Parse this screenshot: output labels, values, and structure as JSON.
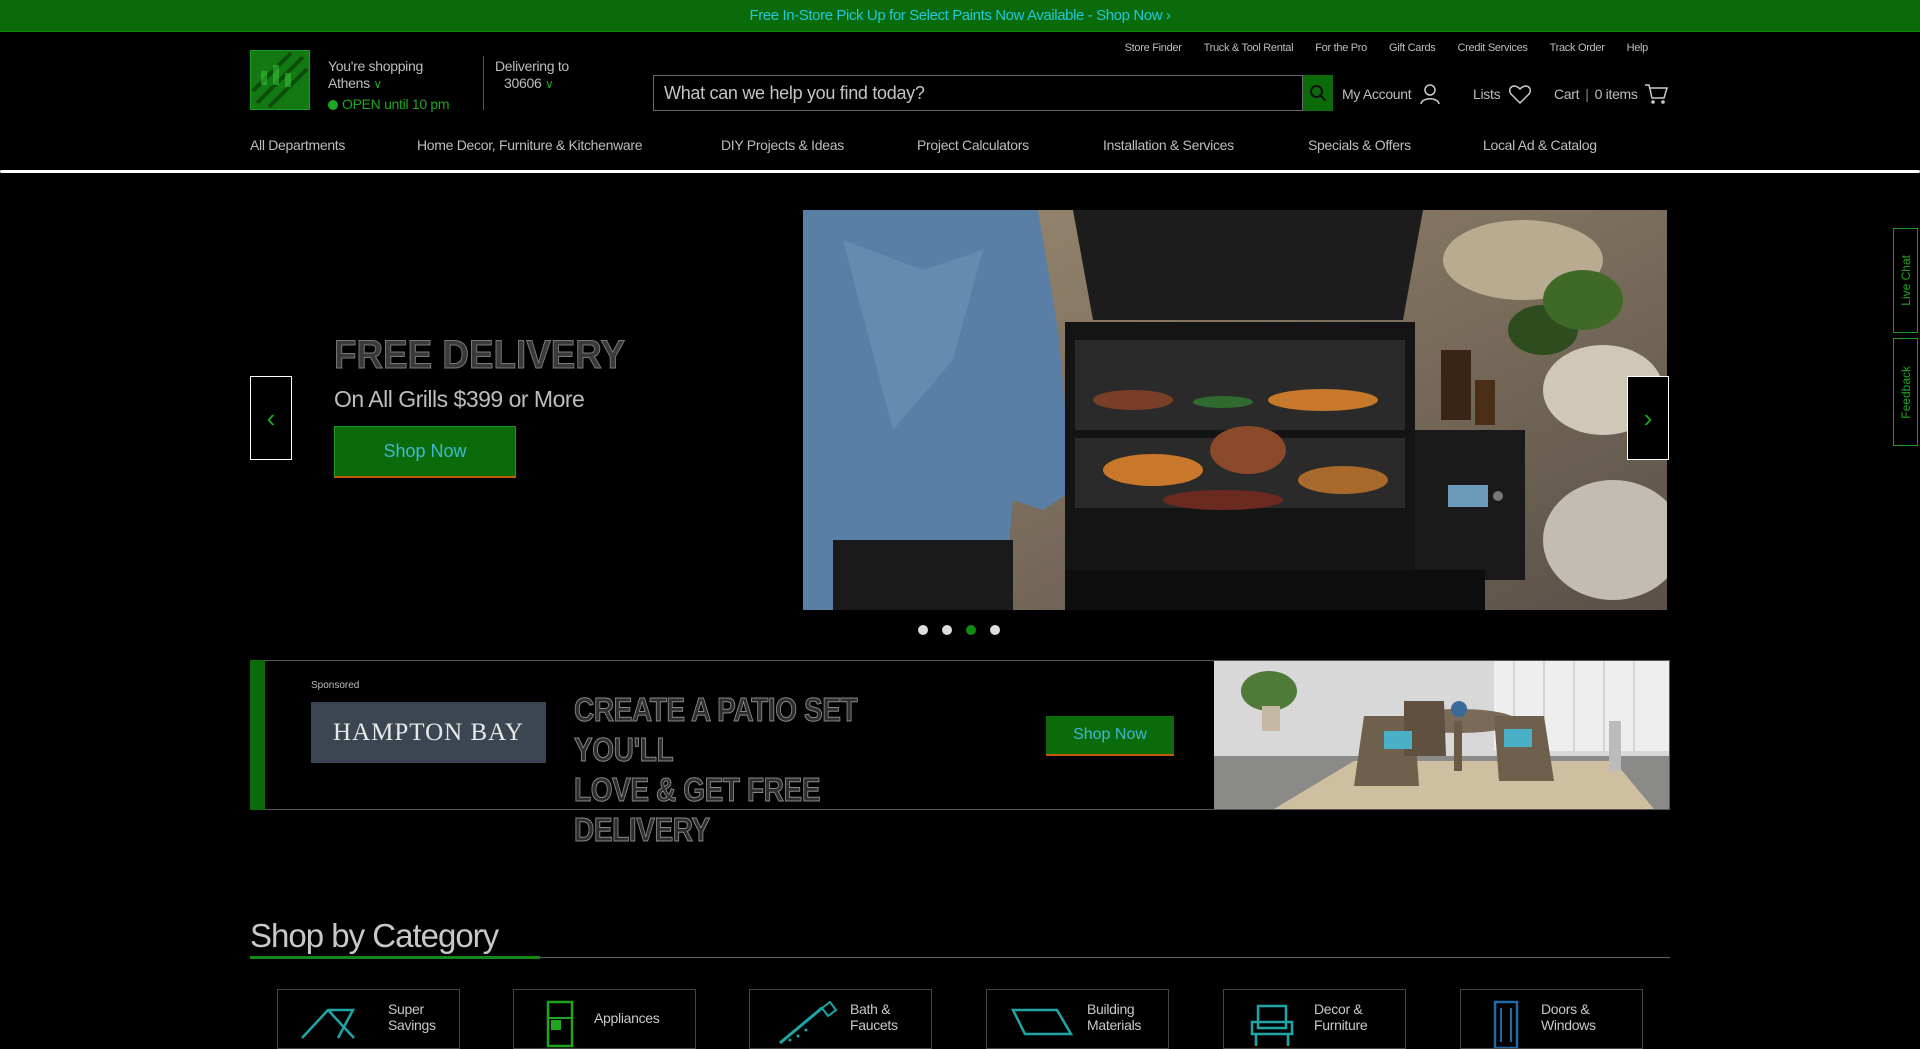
{
  "promo": {
    "text": "Free In-Store Pick Up for Select Paints Now Available - Shop Now ›"
  },
  "header": {
    "shopping_label": "You're shopping",
    "store_name": "Athens",
    "open_status": "OPEN until 10 pm",
    "delivering_label": "Delivering to",
    "zip": "30606",
    "utility_links": [
      "Store Finder",
      "Truck & Tool Rental",
      "For the Pro",
      "Gift Cards",
      "Credit Services",
      "Track Order",
      "Help"
    ],
    "search_placeholder": "What can we help you find today?",
    "account_label": "My Account",
    "lists_label": "Lists",
    "cart_label": "Cart",
    "cart_count": "0 items"
  },
  "nav": {
    "items": [
      "All Departments",
      "Home Decor, Furniture & Kitchenware",
      "DIY Projects & Ideas",
      "Project Calculators",
      "Installation & Services",
      "Specials & Offers",
      "Local Ad & Catalog"
    ]
  },
  "hero": {
    "title": "FREE DELIVERY",
    "subtitle": "On All Grills $399 or More",
    "button": "Shop Now",
    "slides": 4,
    "active_slide": 3
  },
  "sponsored": {
    "label": "Sponsored",
    "brand": "HAMPTON BAY",
    "headline_line1": "CREATE A PATIO SET YOU'LL",
    "headline_line2": "LOVE & GET FREE DELIVERY",
    "button": "Shop Now"
  },
  "category": {
    "title": "Shop by Category",
    "items": [
      {
        "line1": "Super",
        "line2": "Savings",
        "icon": "tag-icon"
      },
      {
        "line1": "Appliances",
        "line2": "",
        "icon": "refrigerator-icon"
      },
      {
        "line1": "Bath &",
        "line2": "Faucets",
        "icon": "shower-icon"
      },
      {
        "line1": "Building",
        "line2": "Materials",
        "icon": "lumber-icon"
      },
      {
        "line1": "Decor &",
        "line2": "Furniture",
        "icon": "chair-icon"
      },
      {
        "line1": "Doors &",
        "line2": "Windows",
        "icon": "door-icon"
      }
    ]
  },
  "side_tabs": {
    "live_chat": "Live Chat",
    "feedback": "Feedback"
  },
  "colors": {
    "brand_green": "#0b6b0b",
    "accent_green": "#1ea61e",
    "accent_orange": "#c45a0a"
  }
}
